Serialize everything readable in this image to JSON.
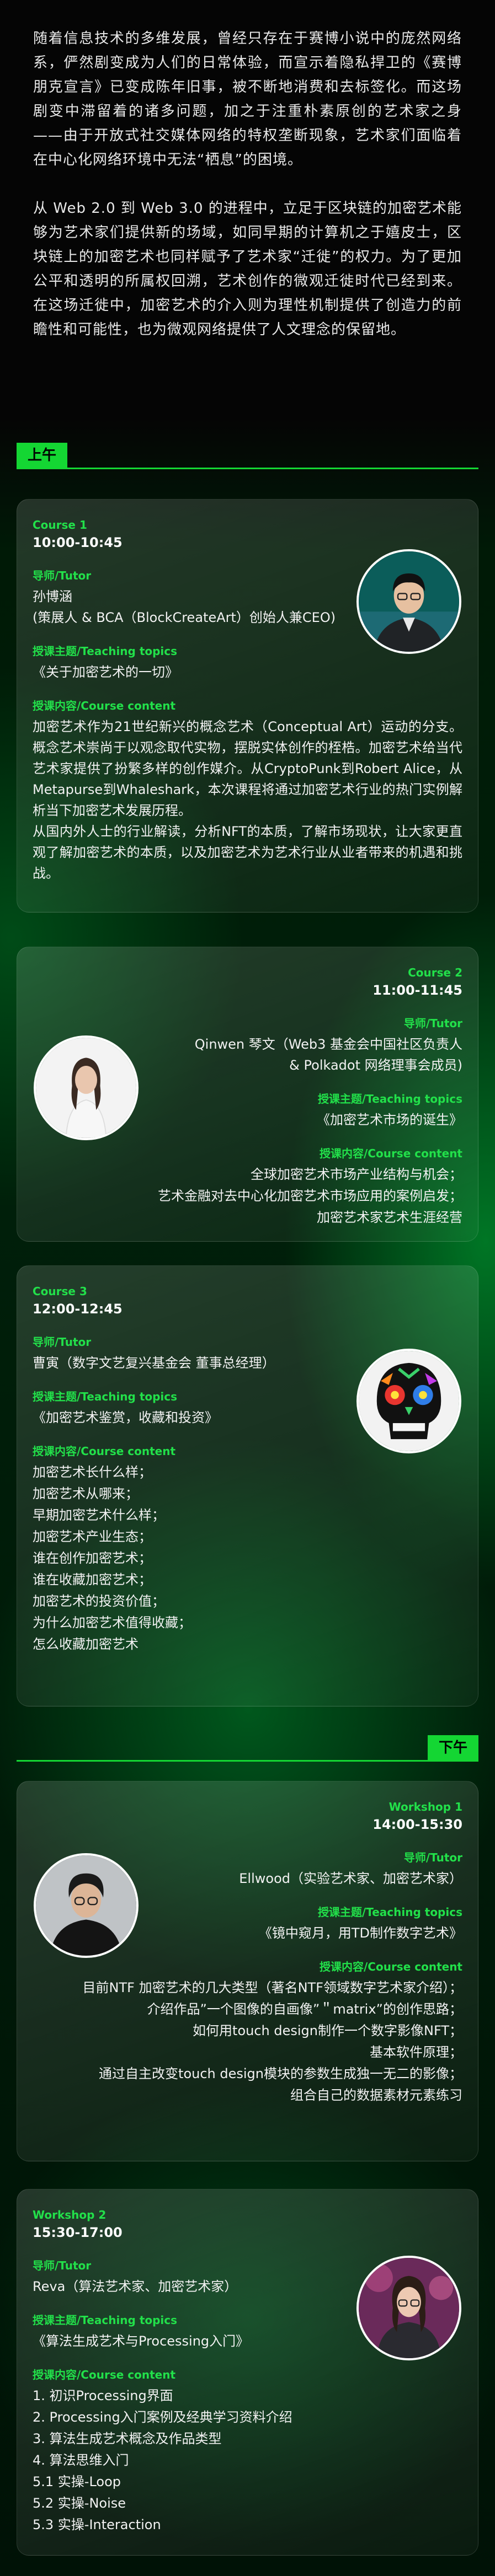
{
  "intro": {
    "p1": "随着信息技术的多维发展，曾经只存在于赛博小说中的庞然网络系，俨然剧变成为人们的日常体验，而宣示着隐私捍卫的《赛博朋克宣言》已变成陈年旧事，被不断地消费和去标签化。而这场剧变中滞留着的诸多问题，加之于注重朴素原创的艺术家之身——由于开放式社交媒体网络的特权垄断现象，艺术家们面临着在中心化网络环境中无法“栖息”的困境。",
    "p2": "从 Web 2.0 到 Web 3.0 的进程中，立足于区块链的加密艺术能够为艺术家们提供新的场域，如同早期的计算机之于嬉皮士，区块链上的加密艺术也同样赋予了艺术家“迁徙”的权力。为了更加公平和透明的所属权回溯，艺术创作的微观迁徙时代已经到来。在这场迁徙中，加密艺术的介入则为理性机制提供了创造力的前瞻性和可能性，也为微观网络提供了人文理念的保留地。"
  },
  "sections": {
    "am": "上午",
    "pm": "下午"
  },
  "labels": {
    "tutor": "导师/Tutor",
    "topic": "授课主题/Teaching topics",
    "content": "授课内容/Course content"
  },
  "course1": {
    "code": "Course 1",
    "time": "10:00-10:45",
    "tutor_name": "孙博涵",
    "tutor_title": "(策展人 & BCA（BlockCreateArt）创始人兼CEO)",
    "topic": "《关于加密艺术的一切》",
    "content1": "加密艺术作为21世纪新兴的概念艺术（Conceptual  Art）运动的分支。概念艺术崇尚于以观念取代实物，摆脱实体创作的桎梏。加密艺术给当代艺术家提供了扮繁多样的创作媒介。从CryptoPunk到Robert  Alice，从Metapurse到Whaleshark，本次课程将通过加密艺术行业的热门实例解析当下加密艺术发展历程。",
    "content2": "从国内外人士的行业解读，分析NFT的本质，了解市场现状，让大家更直观了解加密艺术的本质，以及加密艺术为艺术行业从业者带来的机遇和挑战。"
  },
  "course2": {
    "code": "Course 2",
    "time": "11:00-11:45",
    "tutor_line1": "Qinwen 琴文（Web3 基金会中国社区负责人",
    "tutor_line2": "& Polkadot 网络理事会成员)",
    "topic": "《加密艺术市场的诞生》",
    "content": [
      "全球加密艺术市场产业结构与机会；",
      "艺术金融对去中心化加密艺术市场应用的案例启发；",
      "加密艺术家艺术生涯经营"
    ]
  },
  "course3": {
    "code": "Course 3",
    "time": "12:00-12:45",
    "tutor_name": "曹寅（数字文艺复兴基金会 董事总经理）",
    "topic": "《加密艺术鉴赏，收藏和投资》",
    "content": [
      "加密艺术长什么样；",
      "加密艺术从哪来；",
      "早期加密艺术什么样；",
      "加密艺术产业生态；",
      "谁在创作加密艺术；",
      "谁在收藏加密艺术；",
      "加密艺术的投资价值；",
      "为什么加密艺术值得收藏；",
      "怎么收藏加密艺术"
    ]
  },
  "workshop1": {
    "code": "Workshop 1",
    "time": "14:00-15:30",
    "tutor_name": "Ellwood（实验艺术家、加密艺术家）",
    "topic": "《镜中窥月，用TD制作数字艺术》",
    "content": [
      "目前NTF 加密艺术的几大类型（著名NTF领域数字艺术家介绍）；",
      "介绍作品”一个图像的自画像”＂matrix”的创作思路；",
      "如何用touch design制作一个数字影像NFT；",
      "基本软件原理；",
      "通过自主改变touch design模块的参数生成独一无二的影像；",
      "组合自己的数据素材元素练习"
    ]
  },
  "workshop2": {
    "code": "Workshop 2",
    "time": "15:30-17:00",
    "tutor_name": "Reva（算法艺术家、加密艺术家）",
    "topic": "《算法生成艺术与Processing入门》",
    "content": [
      "1. 初识Processing界面",
      "2. Processing入门案例及经典学习资料介绍",
      "3. 算法生成艺术概念及作品类型",
      "4. 算法思维入门",
      "5.1 实操-Loop",
      "5.2 实操-Noise",
      "5.3 实操-Interaction"
    ]
  },
  "colors": {
    "accent": "#22e04a",
    "tag": "#14d633",
    "background": "#000000"
  }
}
